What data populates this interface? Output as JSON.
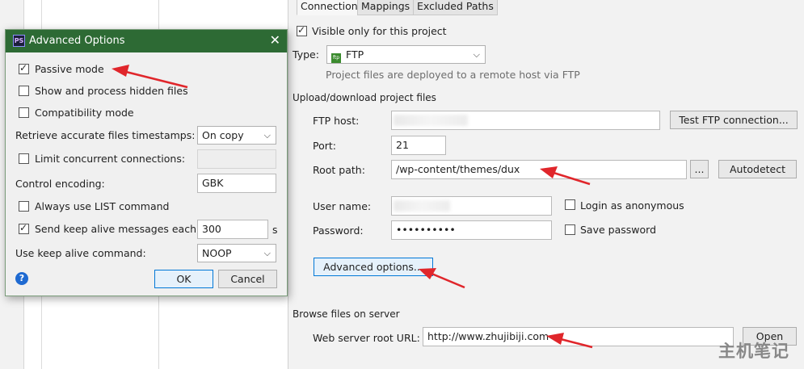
{
  "tabs": [
    "Connection",
    "Mappings",
    "Excluded Paths"
  ],
  "connection": {
    "visible_only_label": "Visible only for this project",
    "type_label": "Type:",
    "type_value": "FTP",
    "type_icon": "ftp-icon",
    "type_hint": "Project files are deployed to a remote host via FTP",
    "section_upload": "Upload/download project files",
    "ftp_host_label": "FTP host:",
    "test_ftp_button": "Test FTP connection...",
    "port_label": "Port:",
    "port_value": "21",
    "root_path_label": "Root path:",
    "root_path_value": "/wp-content/themes/dux",
    "browse_button": "...",
    "autodetect_button": "Autodetect",
    "user_name_label": "User name:",
    "login_anonymous_label": "Login as anonymous",
    "password_label": "Password:",
    "password_value": "••••••••••",
    "save_password_label": "Save password",
    "advanced_options_button": "Advanced options...",
    "section_browse": "Browse files on server",
    "web_root_label": "Web server root URL:",
    "web_root_value": "http://www.zhujibiji.com",
    "open_button": "Open"
  },
  "dialog": {
    "title": "Advanced Options",
    "app_icon_text": "PS",
    "passive_mode_label": "Passive mode",
    "show_hidden_label": "Show and process hidden files",
    "compat_mode_label": "Compatibility mode",
    "timestamps_label": "Retrieve accurate files timestamps:",
    "timestamps_value": "On copy",
    "limit_conn_label": "Limit concurrent connections:",
    "encoding_label": "Control encoding:",
    "encoding_value": "GBK",
    "list_cmd_label": "Always use LIST command",
    "keepalive_label": "Send keep alive messages each:",
    "keepalive_value": "300",
    "keepalive_unit": "s",
    "keepalive_cmd_label": "Use keep alive command:",
    "keepalive_cmd_value": "NOOP",
    "ok_button": "OK",
    "cancel_button": "Cancel",
    "help_icon_text": "?"
  },
  "watermark": "主机笔记",
  "colors": {
    "arrow": "#e0262b",
    "dialog_title_bg": "#2d6a34",
    "help_icon": "#1f6ad1"
  }
}
